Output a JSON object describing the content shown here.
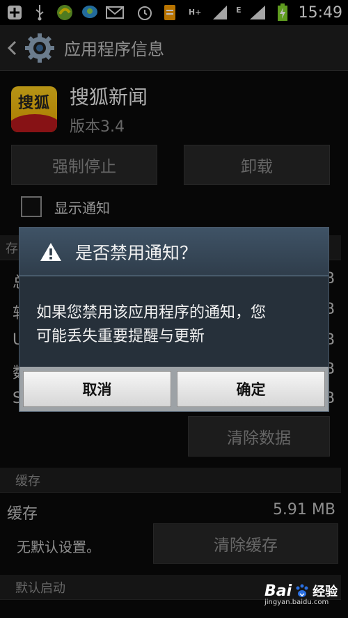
{
  "status_bar": {
    "time": "15:49",
    "network_label": "H+",
    "secondary_label": "E",
    "icons": [
      "plus-icon",
      "usb-icon",
      "app-notification-icon",
      "chat-notification-icon",
      "mail-icon",
      "alarm-icon",
      "document-icon",
      "data-arrows-icon",
      "signal-icon",
      "signal-icon",
      "battery-charging-icon"
    ]
  },
  "action_bar": {
    "title": "应用程序信息"
  },
  "app": {
    "icon_text": "搜狐",
    "name": "搜狐新闻",
    "version": "版本3.4"
  },
  "buttons": {
    "force_stop": "强制停止",
    "uninstall": "卸载"
  },
  "notifications": {
    "show_label": "显示通知",
    "checked": false
  },
  "storage_fragments": {
    "section_initial": "存",
    "rows": [
      {
        "label": "总",
        "value": "B"
      },
      {
        "label": "软",
        "value": "B"
      },
      {
        "label": "U",
        "value": "B"
      },
      {
        "label": "数",
        "value": "B"
      },
      {
        "label": "S",
        "value": "B"
      }
    ]
  },
  "clear_data_button": "清除数据",
  "cache": {
    "section": "缓存",
    "label": "缓存",
    "value": "5.91 MB",
    "clear_button": "清除缓存"
  },
  "default_launch": {
    "section": "默认启动",
    "text": "无默认设置。"
  },
  "dialog": {
    "title": "是否禁用通知？",
    "message_line1": "如果您禁用该应用程序的通知，您",
    "message_line2": "可能丢失重要提醒与更新",
    "cancel": "取消",
    "ok": "确定"
  },
  "watermark": {
    "brand": "Bai",
    "product": "经验",
    "url": "jingyan.baidu.com"
  },
  "colors": {
    "dialog_header": "#3f5366",
    "dialog_body": "#26303a",
    "dialog_button_bar": "#9da2a6"
  }
}
